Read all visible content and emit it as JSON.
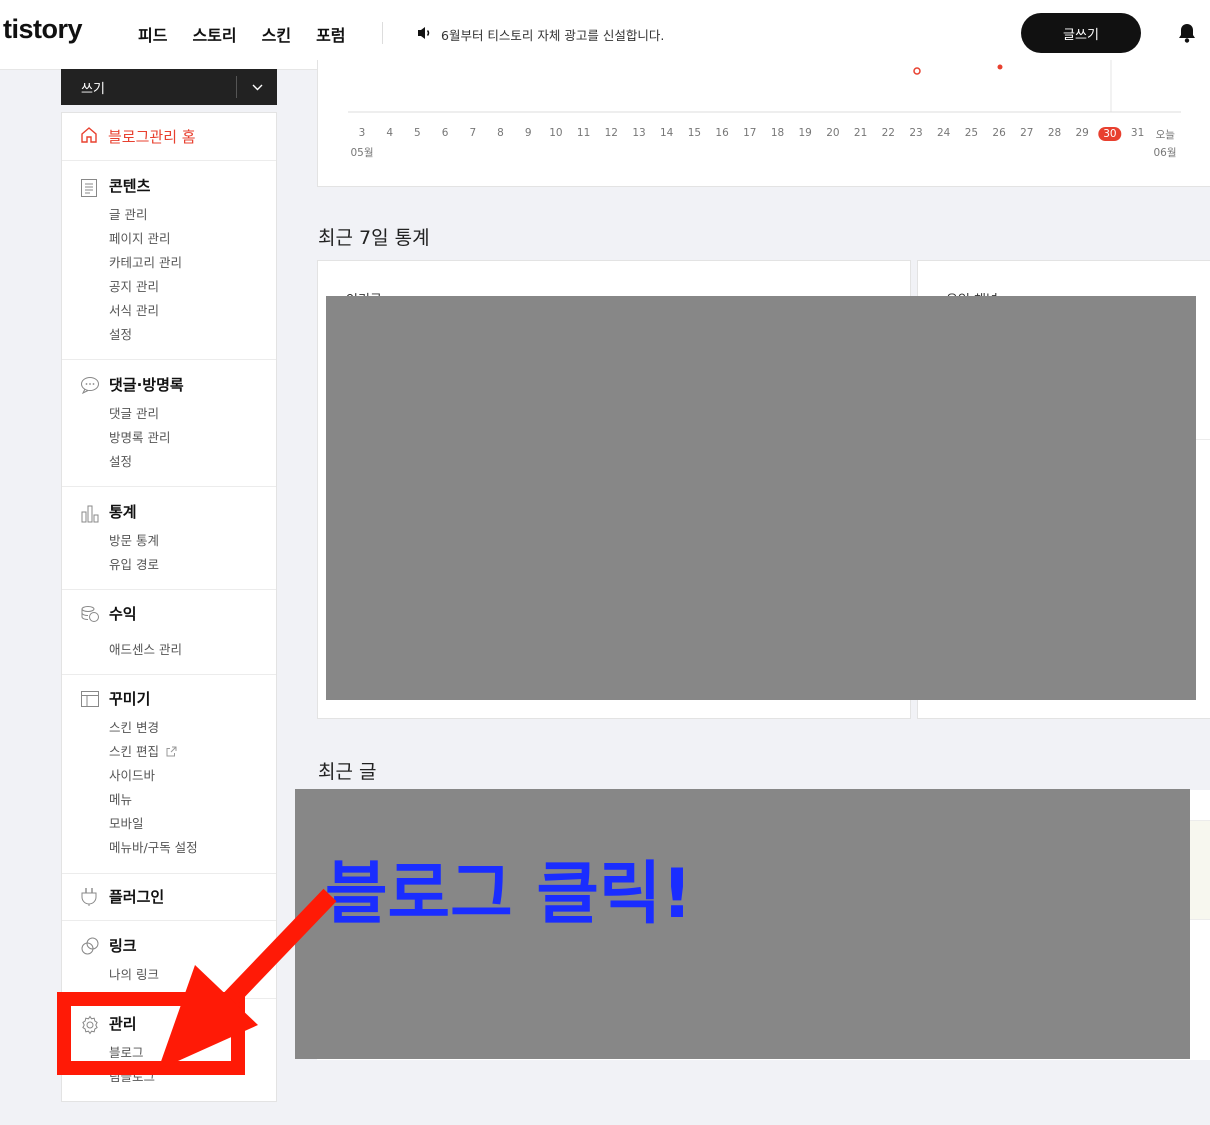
{
  "header": {
    "logo": "tistory",
    "nav": [
      "피드",
      "스토리",
      "스킨",
      "포럼"
    ],
    "notice": "6월부터 티스토리 자체 광고를 신설합니다.",
    "write_button": "글쓰기",
    "icons": {
      "notice": "speaker-icon",
      "bell": "bell-icon"
    }
  },
  "sidebar": {
    "write_dropdown": "쓰기",
    "home": "블로그관리 홈",
    "sections": [
      {
        "title": "콘텐츠",
        "icon": "document-icon",
        "items": [
          "글 관리",
          "페이지 관리",
          "카테고리 관리",
          "공지 관리",
          "서식 관리",
          "설정"
        ]
      },
      {
        "title": "댓글·방명록",
        "icon": "comment-icon",
        "items": [
          "댓글 관리",
          "방명록 관리",
          "설정"
        ]
      },
      {
        "title": "통계",
        "icon": "bar-chart-icon",
        "items": [
          "방문 통계",
          "유입 경로"
        ]
      },
      {
        "title": "수익",
        "icon": "coins-icon",
        "items": [
          "애드센스 관리"
        ]
      },
      {
        "title": "꾸미기",
        "icon": "layout-icon",
        "items": [
          "스킨 변경",
          "스킨 편집",
          "사이드바",
          "메뉴",
          "모바일",
          "메뉴바/구독 설정"
        ]
      },
      {
        "title": "플러그인",
        "icon": "plug-icon",
        "items": []
      },
      {
        "title": "링크",
        "icon": "link-icon",
        "items": [
          "나의 링크"
        ]
      },
      {
        "title": "관리",
        "icon": "gear-icon",
        "items": [
          "블로그",
          "팀블로그"
        ]
      }
    ],
    "accent_color": "#e8402f"
  },
  "chart": {
    "x_labels": [
      "3",
      "4",
      "5",
      "6",
      "7",
      "8",
      "9",
      "10",
      "11",
      "12",
      "13",
      "14",
      "15",
      "16",
      "17",
      "18",
      "19",
      "20",
      "21",
      "22",
      "23",
      "24",
      "25",
      "26",
      "27",
      "28",
      "29",
      "30",
      "31",
      "오늘"
    ],
    "highlight": "30",
    "month_start": "05월",
    "month_end": "06월"
  },
  "main": {
    "stats_heading": "최근 7일 통계",
    "recent_heading": "최근 글",
    "popular_label": "인기글",
    "inflow_label": "유입 채널"
  },
  "annotation": {
    "text": "블로그 클릭!",
    "text_color": "#1a2dff",
    "marker_color": "#ff1a06"
  }
}
